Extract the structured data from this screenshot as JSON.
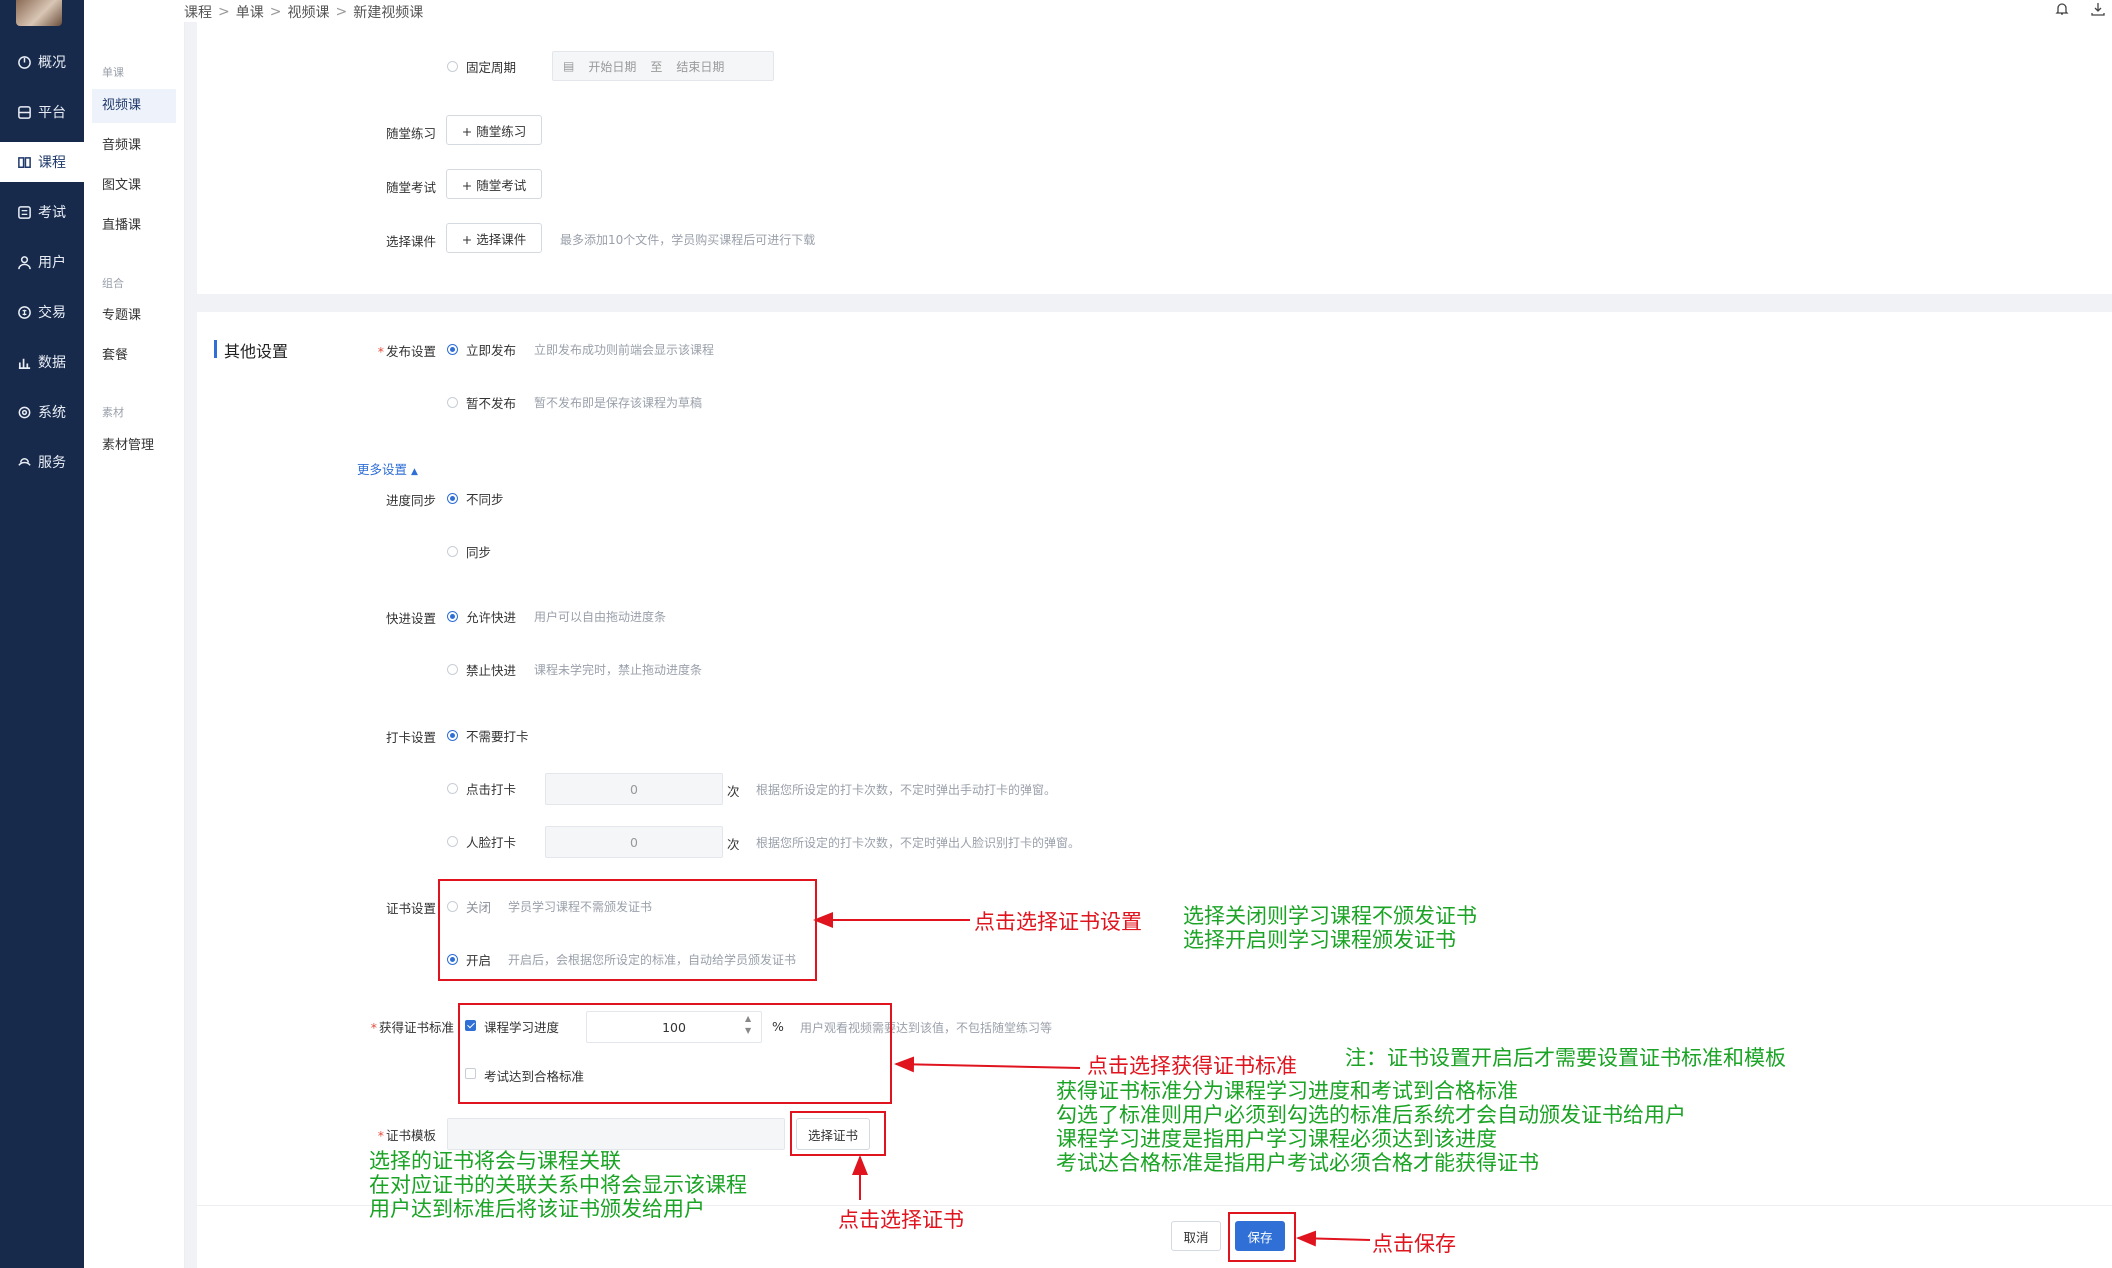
{
  "nav": {
    "items": [
      {
        "label": "概况",
        "icon": "dashboard-icon"
      },
      {
        "label": "平台",
        "icon": "platform-icon"
      },
      {
        "label": "课程",
        "icon": "book-icon"
      },
      {
        "label": "考试",
        "icon": "exam-icon"
      },
      {
        "label": "用户",
        "icon": "user-icon"
      },
      {
        "label": "交易",
        "icon": "trade-icon"
      },
      {
        "label": "数据",
        "icon": "chart-icon"
      },
      {
        "label": "系统",
        "icon": "gear-icon"
      },
      {
        "label": "服务",
        "icon": "service-icon"
      }
    ]
  },
  "subnav": {
    "group1": "单课",
    "items1": [
      "视频课",
      "音频课",
      "图文课",
      "直播课"
    ],
    "group2": "组合",
    "items2": [
      "专题课",
      "套餐"
    ],
    "group3": "素材",
    "items3": [
      "素材管理"
    ]
  },
  "breadcrumb": [
    "课程",
    "单课",
    "视频课",
    "新建视频课"
  ],
  "top_form": {
    "fixed_period": "固定周期",
    "start_date": "开始日期",
    "to": "至",
    "end_date": "结束日期",
    "practice_label": "随堂练习",
    "practice_btn": "+ 随堂练习",
    "exam_label": "随堂考试",
    "exam_btn": "+ 随堂考试",
    "courseware_label": "选择课件",
    "courseware_btn": "+ 选择课件",
    "courseware_hint": "最多添加10个文件，学员购买课程后可进行下载"
  },
  "other": {
    "section_title": "其他设置",
    "publish_label": "发布设置",
    "publish_now": "立即发布",
    "publish_now_hint": "立即发布成功则前端会显示该课程",
    "publish_later": "暂不发布",
    "publish_later_hint": "暂不发布即是保存该课程为草稿",
    "more": "更多设置",
    "progress_label": "进度同步",
    "no_sync": "不同步",
    "sync": "同步",
    "ff_label": "快进设置",
    "ff_allow": "允许快进",
    "ff_allow_hint": "用户可以自由拖动进度条",
    "ff_forbid": "禁止快进",
    "ff_forbid_hint": "课程未学完时，禁止拖动进度条",
    "checkin_label": "打卡设置",
    "checkin_none": "不需要打卡",
    "checkin_click": "点击打卡",
    "checkin_click_value": "0",
    "unit": "次",
    "checkin_click_hint": "根据您所设定的打卡次数，不定时弹出手动打卡的弹窗。",
    "checkin_face": "人脸打卡",
    "checkin_face_value": "0",
    "checkin_face_hint": "根据您所设定的打卡次数，不定时弹出人脸识别打卡的弹窗。",
    "cert_label": "证书设置",
    "cert_off": "关闭",
    "cert_off_hint": "学员学习课程不需颁发证书",
    "cert_on": "开启",
    "cert_on_hint": "开启后，会根据您所设定的标准，自动给学员颁发证书",
    "std_label": "获得证书标准",
    "std_progress": "课程学习进度",
    "std_progress_value": "100",
    "percent": "%",
    "std_progress_hint": "用户观看视频需要达到该值，不包括随堂练习等",
    "std_exam": "考试达到合格标准",
    "tpl_label": "证书模板",
    "tpl_btn": "选择证书",
    "cancel": "取消",
    "save": "保存"
  },
  "annotations": {
    "click_cert_setting": "点击选择证书设置",
    "cert_explain": [
      "选择关闭则学习课程不颁发证书",
      "选择开启则学习课程颁发证书"
    ],
    "click_std": "点击选择获得证书标准",
    "std_note": "注：证书设置开启后才需要设置证书标准和模板",
    "std_explain": [
      "获得证书标准分为课程学习进度和考试到合格标准",
      "勾选了标准则用户必须到勾选的标准后系统才会自动颁发证书给用户",
      "课程学习进度是指用户学习课程必须达到该进度",
      "考试达合格标准是指用户考试必须合格才能获得证书"
    ],
    "tpl_explain": [
      "选择的证书将会与课程关联",
      "在对应证书的关联关系中将会显示该课程",
      "用户达到标准后将该证书颁发给用户"
    ],
    "click_choose_cert": "点击选择证书",
    "click_save": "点击保存"
  }
}
